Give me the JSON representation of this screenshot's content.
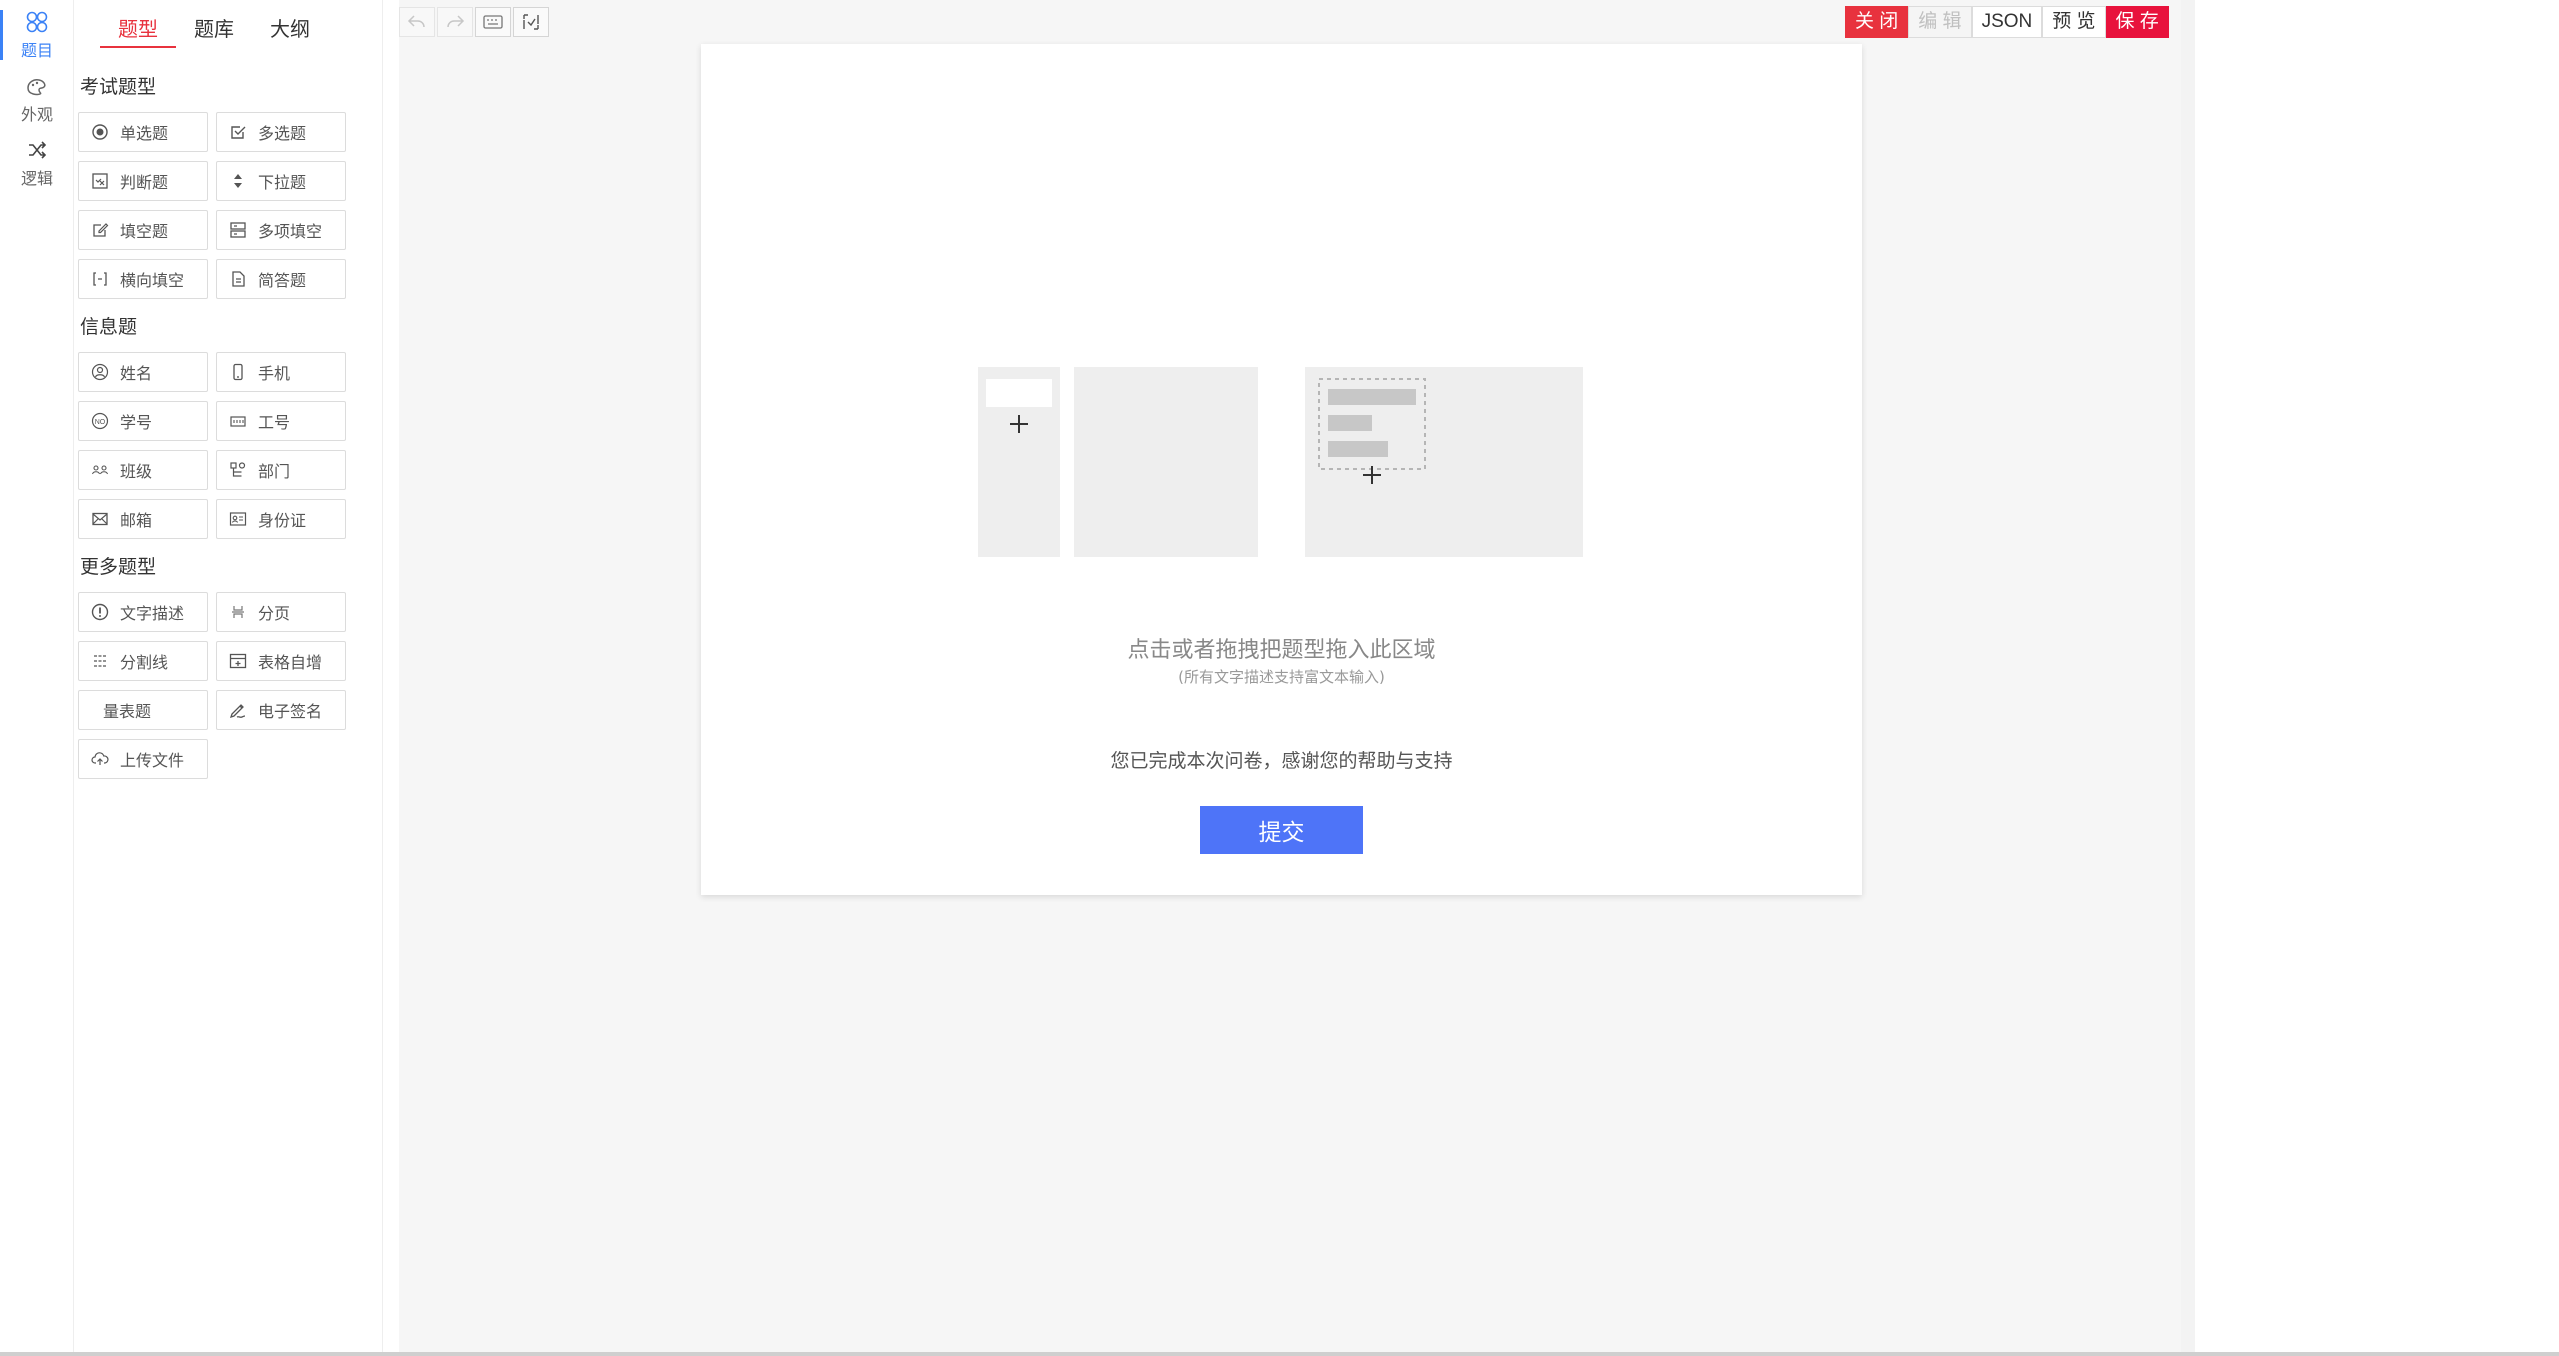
{
  "rail": {
    "items": [
      {
        "label": "题目",
        "icon": "questions-icon"
      },
      {
        "label": "外观",
        "icon": "palette-icon"
      },
      {
        "label": "逻辑",
        "icon": "shuffle-icon"
      }
    ]
  },
  "panel": {
    "tabs": [
      "题型",
      "题库",
      "大纲"
    ],
    "groups": [
      {
        "title": "考试题型",
        "items": [
          "单选题",
          "多选题",
          "判断题",
          "下拉题",
          "填空题",
          "多项填空",
          "横向填空",
          "简答题"
        ]
      },
      {
        "title": "信息题",
        "items": [
          "姓名",
          "手机",
          "学号",
          "工号",
          "班级",
          "部门",
          "邮箱",
          "身份证"
        ]
      },
      {
        "title": "更多题型",
        "items": [
          "文字描述",
          "分页",
          "分割线",
          "表格自增",
          "量表题",
          "电子签名",
          "上传文件"
        ]
      }
    ]
  },
  "toolbar": {
    "buttons": [
      "undo-icon",
      "redo-icon",
      "keyboard-icon",
      "snapshot-icon"
    ]
  },
  "actions": {
    "close": "关 闭",
    "edit": "编 辑",
    "json": "JSON",
    "preview": "预 览",
    "save": "保 存"
  },
  "sheet": {
    "hint_main": "点击或者拖拽把题型拖入此区域",
    "hint_sub": "(所有文字描述支持富文本输入)",
    "thanks": "您已完成本次问卷，感谢您的帮助与支持",
    "submit": "提交"
  },
  "colors": {
    "accent_red": "#e8323e",
    "submit_blue": "#4e74f8",
    "rail_active": "#3b82f6"
  }
}
